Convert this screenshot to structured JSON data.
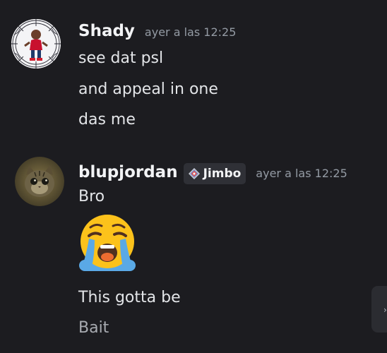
{
  "messages": [
    {
      "username": "Shady",
      "timestamp": "ayer a las 12:25",
      "avatar_icon": "avatar-child-spiderweb-frame",
      "lines": [
        "see dat psl",
        "and appeal in one",
        "das me"
      ]
    },
    {
      "username": "blupjordan",
      "tag": "Jimbo",
      "tag_icon": "diamond-badge-icon",
      "timestamp": "ayer a las 12:25",
      "avatar_icon": "avatar-kitten",
      "lines": [
        "Bro"
      ],
      "emoji": "loudly-crying-face",
      "lines_after": [
        "This gotta be",
        "Bait"
      ]
    }
  ],
  "colors": {
    "background": "#1c1c20",
    "username": "#f2f3f5",
    "timestamp": "#949ba4",
    "text": "#e3e5e8"
  }
}
